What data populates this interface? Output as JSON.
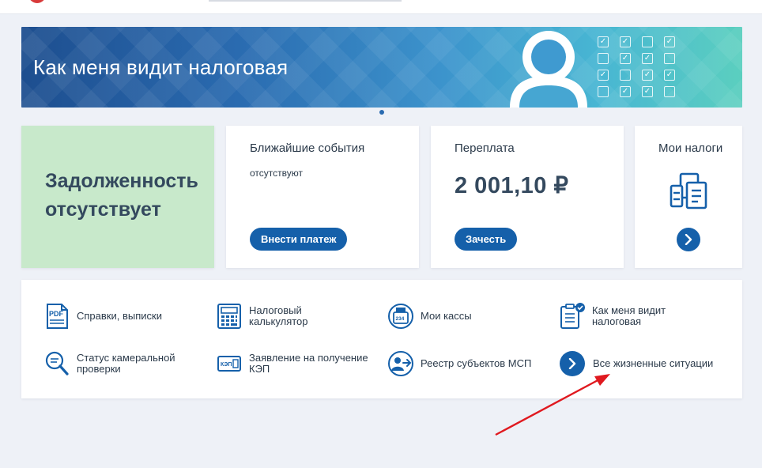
{
  "banner": {
    "title": "Как меня видит налоговая"
  },
  "cards": {
    "debt": {
      "text": "Задолженность отсутствует"
    },
    "events": {
      "title": "Ближайшие события",
      "status": "отсутствуют",
      "button": "Внести платеж"
    },
    "overpay": {
      "title": "Переплата",
      "amount": "2 001,10 ₽",
      "button": "Зачесть"
    },
    "taxes": {
      "title": "Мои налоги"
    }
  },
  "services": [
    {
      "label": "Справки, выписки",
      "icon": "pdf-document-icon"
    },
    {
      "label": "Налоговый\nкалькулятор",
      "icon": "calculator-icon"
    },
    {
      "label": "Мои кассы",
      "icon": "cash-register-icon"
    },
    {
      "label": "Как меня видит\nналоговая",
      "icon": "checklist-icon"
    },
    {
      "label": "Статус камеральной\nпроверки",
      "icon": "magnifier-icon"
    },
    {
      "label": "Заявление на получение\nКЭП",
      "icon": "signature-card-icon"
    },
    {
      "label": "Реестр субъектов МСП",
      "icon": "registry-user-icon"
    },
    {
      "label": "Все жизненные ситуации",
      "icon": "chevron-right-icon"
    }
  ],
  "colors": {
    "accent": "#1560aa",
    "debt_bg": "#c8e9cb",
    "annotation_arrow": "#e0191f"
  }
}
